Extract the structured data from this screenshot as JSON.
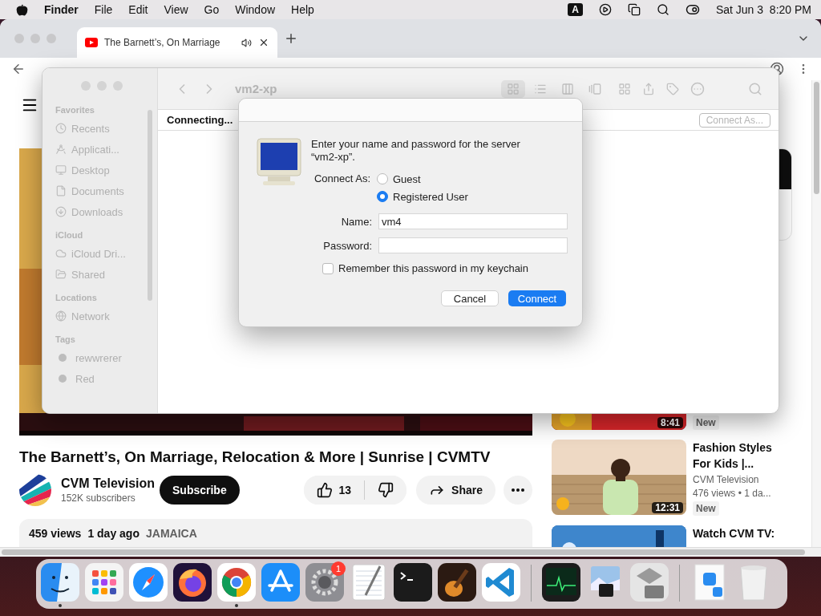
{
  "menu_bar": {
    "app_name": "Finder",
    "menus": [
      "File",
      "Edit",
      "View",
      "Go",
      "Window",
      "Help"
    ],
    "input_source": "A",
    "clock": "Sat Jun 3  8:20 PM"
  },
  "browser": {
    "tabs": [
      {
        "title": "The Barnett’s, On Marriage",
        "playing_audio": true,
        "selected": true
      }
    ],
    "video": {
      "title": "The Barnett’s, On Marriage, Relocation & More | Sunrise | CVMTV",
      "channel": "CVM Television",
      "subscribers": "152K subscribers",
      "subscribe_label": "Subscribe",
      "likes": "13",
      "share_label": "Share",
      "views": "459 views",
      "age": "1 day ago",
      "location": "JAMAICA"
    },
    "recommended": [
      {
        "kind": "warm",
        "duration": "8:41",
        "badge": "New"
      },
      {
        "kind": "figure",
        "title": "Fashion Styles For Kids |...",
        "channel": "CVM Television",
        "views": "476 views",
        "age": "• 1 da...",
        "duration": "12:31",
        "badge": "New"
      },
      {
        "kind": "blue",
        "title": "Watch CVM TV:"
      }
    ]
  },
  "finder": {
    "title": "vm2-xp",
    "status": "Connecting...",
    "connect_as": {
      "label": "Connect As...",
      "disabled": true
    },
    "sidebar": [
      {
        "heading": "Favorites",
        "items": [
          {
            "label": "Recents",
            "kind": "recents"
          },
          {
            "label": "Applicati...",
            "kind": "apps"
          },
          {
            "label": "Desktop",
            "kind": "desktop"
          },
          {
            "label": "Documents",
            "kind": "documents"
          },
          {
            "label": "Downloads",
            "kind": "downloads"
          }
        ]
      },
      {
        "heading": "iCloud",
        "items": [
          {
            "label": "iCloud Dri...",
            "kind": "cloud"
          },
          {
            "label": "Shared",
            "kind": "shared"
          }
        ]
      },
      {
        "heading": "Locations",
        "items": [
          {
            "label": "Network",
            "kind": "network"
          }
        ]
      },
      {
        "heading": "Tags",
        "items": [
          {
            "label": "rewwrerer",
            "kind": "tag"
          },
          {
            "label": "Red",
            "kind": "tag"
          }
        ]
      }
    ]
  },
  "dialog": {
    "message": "Enter your name and password for the server “vm2-xp”.",
    "connect_as_label": "Connect As:",
    "options": [
      {
        "label": "Guest",
        "selected": false
      },
      {
        "label": "Registered User",
        "selected": true
      }
    ],
    "fields": [
      {
        "label": "Name:",
        "value": "vm4"
      },
      {
        "label": "Password:"
      }
    ],
    "remember": {
      "label": "Remember this password in my keychain",
      "checked": false
    },
    "buttons": [
      {
        "label": "Cancel",
        "default": false
      },
      {
        "label": "Connect",
        "default": true
      }
    ]
  },
  "dock": {
    "apps": [
      {
        "kind": "finder",
        "running": true
      },
      {
        "kind": "launchpad",
        "running": false
      },
      {
        "kind": "safari",
        "running": false
      },
      {
        "kind": "firefox",
        "running": false
      },
      {
        "kind": "chrome",
        "running": true
      },
      {
        "kind": "appstore",
        "running": false
      },
      {
        "kind": "settings",
        "running": false,
        "badge": "1"
      },
      {
        "kind": "textedit",
        "running": false
      },
      {
        "kind": "terminal",
        "running": false
      },
      {
        "kind": "garageband",
        "running": false
      },
      {
        "kind": "vscode",
        "running": false
      },
      {
        "kind": "separator"
      },
      {
        "kind": "activity",
        "running": false
      },
      {
        "kind": "preview",
        "running": false
      },
      {
        "kind": "bootcamp",
        "running": false
      },
      {
        "kind": "separator"
      },
      {
        "kind": "stack"
      },
      {
        "kind": "trash"
      }
    ]
  }
}
